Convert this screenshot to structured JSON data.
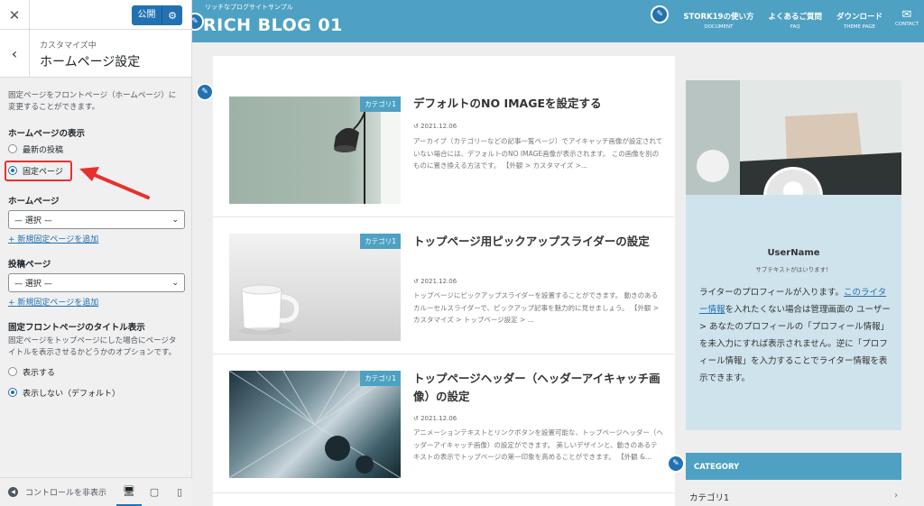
{
  "sidebar": {
    "close_icon": "close-icon",
    "publish_label": "公開",
    "header": {
      "preface": "カスタマイズ中",
      "title": "ホームページ設定"
    },
    "description": "固定ページをフロントページ（ホームページ）に変更することができます。",
    "homepage_display": {
      "label": "ホームページの表示",
      "options": [
        "最新の投稿",
        "固定ページ"
      ],
      "selected": "固定ページ"
    },
    "homepage_select": {
      "label": "ホームページ",
      "value": "— 選択 —",
      "add_link": "+ 新規固定ページを追加"
    },
    "posts_select": {
      "label": "投稿ページ",
      "value": "— 選択 —",
      "add_link": "+ 新規固定ページを追加"
    },
    "front_title": {
      "label": "固定フロントページのタイトル表示",
      "description": "固定ページをトップページにした場合にページタイトルを表示させるかどうかのオプションです。",
      "options": [
        "表示する",
        "表示しない（デフォルト）"
      ],
      "selected": "表示しない（デフォルト）"
    },
    "footer": {
      "hide_controls": "コントロールを非表示"
    }
  },
  "preview": {
    "header": {
      "tagline": "リッチなブログサイトサンプル",
      "logo": "RICH BLOG 01",
      "nav": [
        {
          "main": "STORK19の使い方",
          "sub": "DOCUMENT"
        },
        {
          "main": "よくあるご質問",
          "sub": "FAQ"
        },
        {
          "main": "ダウンロード",
          "sub": "THEME PAGE"
        }
      ],
      "contact": "CONTACT"
    },
    "posts": [
      {
        "category": "カテゴリ1",
        "title": "デフォルトのNO IMAGEを設定する",
        "date": "2021.12.06",
        "excerpt": "アーカイブ（カテゴリーなどの記事一覧ページ）でアイキャッチ画像が設定されていない場合には、デフォルトのNO IMAGE画像が表示されます。 この画像を別のものに置き換える方法です。 【外観 > カスタマイズ >..."
      },
      {
        "category": "カテゴリ1",
        "title": "トップページ用ピックアップスライダーの設定",
        "date": "2021.12.06",
        "excerpt": "トップページにピックアップスライダーを設置することができます。 動きのあるカルーセルスライダーで、ピックアップ記事を魅力的に見せましょう。 【外観 > カスタマイズ > トップページ設定 > ..."
      },
      {
        "category": "カテゴリ1",
        "title": "トップページヘッダー（ヘッダーアイキャッチ画像）の設定",
        "date": "2021.12.06",
        "excerpt": "アニメーションテキストとリンクボタンを設置可能な、トップページヘッダー（ヘッダーアイキャッチ画像）の設定ができます。 美しいデザインと、動きのあるテキストの表示でトップページの第一印象を高めることができます。 【外観 &..."
      }
    ],
    "profile": {
      "name": "UserName",
      "subtitle": "サブテキストがはいります！",
      "text_link": "このライター情報",
      "text_before": "ライターのプロフィールが入ります。",
      "text_after": "を入れたくない場合は管理画面の ユーザー > あなたのプロフィールの「プロフィール情報」を未入力にすれば表示されません。逆に「プロフィール情報」を入力することでライター情報を表示できます。"
    },
    "category_widget": {
      "heading": "CATEGORY",
      "items": [
        "カテゴリ1"
      ]
    }
  },
  "colors": {
    "header_blue": "#4ea1c2",
    "wp_blue": "#2271b1",
    "highlight_red": "#e8302f"
  }
}
